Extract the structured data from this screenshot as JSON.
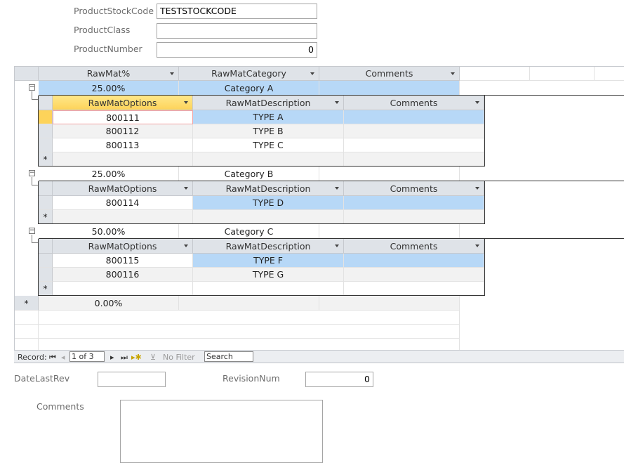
{
  "form": {
    "product_stock_code_label": "ProductStockCode",
    "product_stock_code": "TESTSTOCKCODE",
    "product_class_label": "ProductClass",
    "product_class": "",
    "product_number_label": "ProductNumber",
    "product_number": "0",
    "date_last_rev_label": "DateLastRev",
    "date_last_rev": "",
    "revision_num_label": "RevisionNum",
    "revision_num": "0",
    "comments_label": "Comments",
    "comments": ""
  },
  "datasheet": {
    "columns": [
      "RawMat%",
      "RawMatCategory",
      "Comments"
    ],
    "sub_columns": [
      "RawMatOptions",
      "RawMatDescription",
      "Comments"
    ],
    "records": [
      {
        "pct": "25.00%",
        "category": "Category A",
        "comments": "",
        "options": [
          [
            "800111",
            "TYPE A",
            ""
          ],
          [
            "800112",
            "TYPE B",
            ""
          ],
          [
            "800113",
            "TYPE C",
            ""
          ]
        ]
      },
      {
        "pct": "25.00%",
        "category": "Category B",
        "comments": "",
        "options": [
          [
            "800114",
            "TYPE D",
            ""
          ]
        ]
      },
      {
        "pct": "50.00%",
        "category": "Category C",
        "comments": "",
        "options": [
          [
            "800115",
            "TYPE F",
            ""
          ],
          [
            "800116",
            "TYPE G",
            ""
          ]
        ]
      }
    ],
    "new_row_pct": "0.00%",
    "new_row_marker": "*"
  },
  "nav": {
    "record_label": "Record:",
    "position": "1 of 3",
    "filter": "No Filter",
    "search": "Search"
  }
}
